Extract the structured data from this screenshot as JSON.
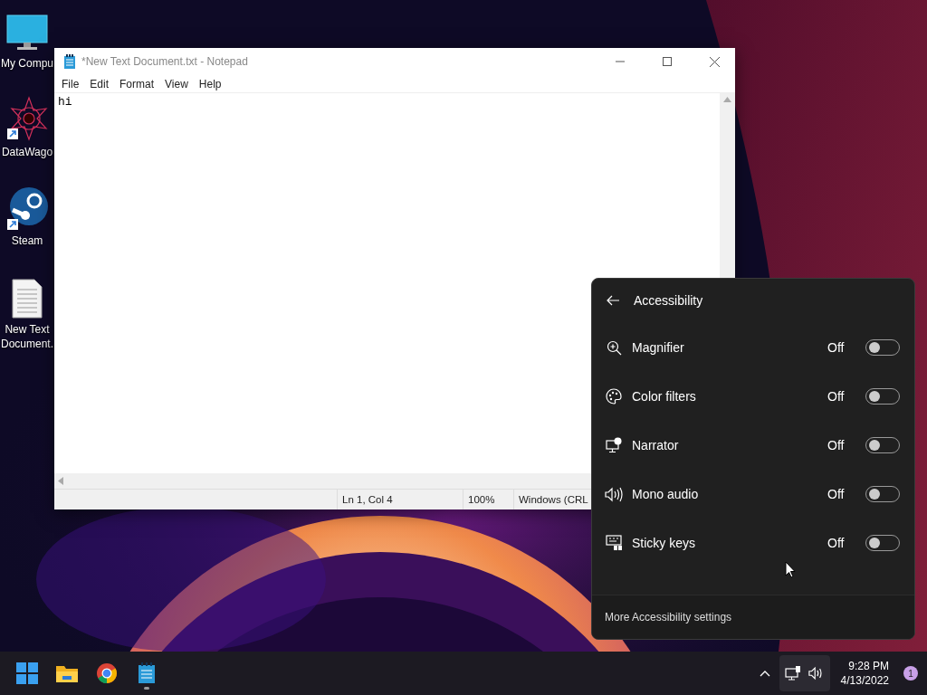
{
  "desktop_icons": [
    {
      "label": "My Compu",
      "shortcut": false
    },
    {
      "label": "DataWago",
      "shortcut": true
    },
    {
      "label": "Steam",
      "shortcut": true
    },
    {
      "label": "New Text Document.",
      "shortcut": false
    }
  ],
  "notepad": {
    "title": "*New Text Document.txt - Notepad",
    "menu": [
      "File",
      "Edit",
      "Format",
      "View",
      "Help"
    ],
    "content": "hi",
    "status_bar": [
      "Ln 1, Col 4",
      "100%",
      "Windows (CRL"
    ]
  },
  "accessibility_flyout": {
    "title": "Accessibility",
    "items": [
      {
        "label": "Magnifier",
        "state": "Off",
        "on": false
      },
      {
        "label": "Color filters",
        "state": "Off",
        "on": false
      },
      {
        "label": "Narrator",
        "state": "Off",
        "on": false
      },
      {
        "label": "Mono audio",
        "state": "Off",
        "on": false
      },
      {
        "label": "Sticky keys",
        "state": "Off",
        "on": false
      }
    ],
    "footer_link": "More Accessibility settings"
  },
  "taskbar": {
    "apps": [
      {
        "running": false
      },
      {
        "running": false
      },
      {
        "running": false
      },
      {
        "running": true
      }
    ],
    "clock": {
      "time": "9:28 PM",
      "date": "4/13/2022"
    },
    "notification_count": "1"
  }
}
